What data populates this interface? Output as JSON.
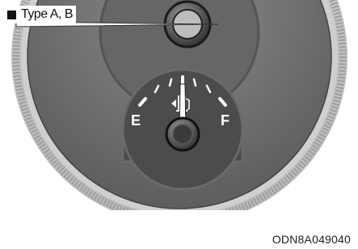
{
  "figure": {
    "type_label": "Type A, B",
    "gauge": {
      "empty_label": "E",
      "full_label": "F",
      "fuel_icon": "fuel-pump-icon",
      "needle_level": 0.5
    },
    "image_code": "ODN8A049040"
  },
  "colors": {
    "bezel": "#d6d6d6",
    "dial_outer": "#7a7a7a",
    "dial_inner": "#5e5e5e",
    "gauge_face": "#4a4a4a",
    "needle": "#ffffff"
  }
}
